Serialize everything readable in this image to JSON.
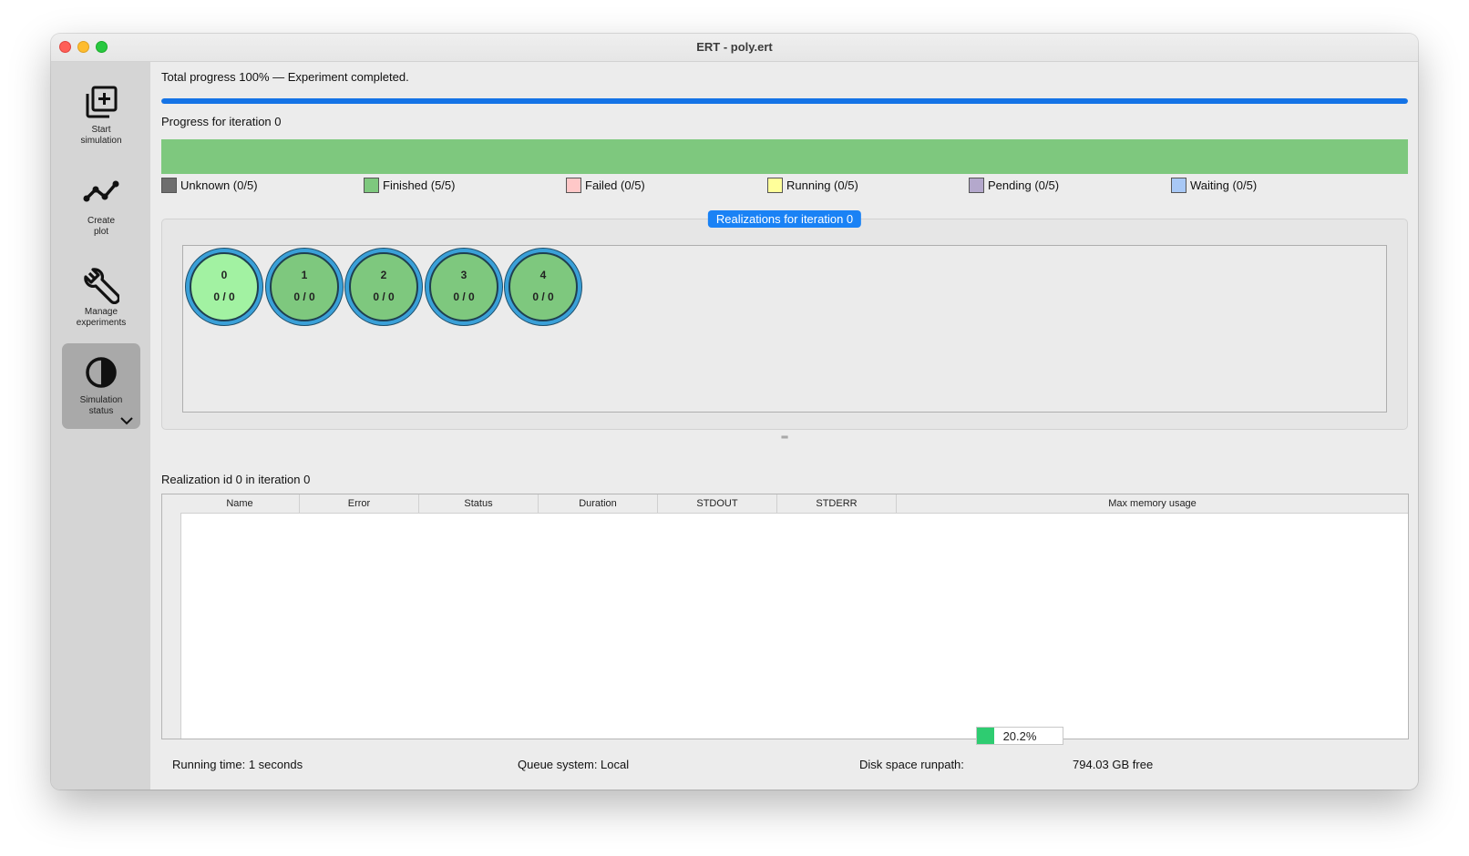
{
  "window": {
    "title": "ERT - poly.ert"
  },
  "sidebar": {
    "items": [
      {
        "label_line1": "Start",
        "label_line2": "simulation",
        "icon": "add-copy-icon"
      },
      {
        "label_line1": "Create",
        "label_line2": "plot",
        "icon": "line-chart-icon"
      },
      {
        "label_line1": "Manage",
        "label_line2": "experiments",
        "icon": "wrench-icon"
      },
      {
        "label_line1": "Simulation",
        "label_line2": "status",
        "icon": "contrast-icon",
        "active": true
      }
    ]
  },
  "progress": {
    "total_text": "Total progress 100% — Experiment completed.",
    "total_fraction": 1.0,
    "iteration_label": "Progress for iteration 0",
    "iteration_fraction": 1.0
  },
  "legend": [
    {
      "label": "Unknown (0/5)",
      "color": "#6e6e6e"
    },
    {
      "label": "Finished (5/5)",
      "color": "#7ec87e"
    },
    {
      "label": "Failed (0/5)",
      "color": "#ffc8c8"
    },
    {
      "label": "Running (0/5)",
      "color": "#ffff9a"
    },
    {
      "label": "Pending (0/5)",
      "color": "#b4a8cc"
    },
    {
      "label": "Waiting (0/5)",
      "color": "#a8c8f5"
    }
  ],
  "realizations": {
    "group_title": "Realizations for iteration 0",
    "items": [
      {
        "id": "0",
        "count": "0 / 0",
        "selected": true
      },
      {
        "id": "1",
        "count": "0 / 0"
      },
      {
        "id": "2",
        "count": "0 / 0"
      },
      {
        "id": "3",
        "count": "0 / 0"
      },
      {
        "id": "4",
        "count": "0 / 0"
      }
    ]
  },
  "details": {
    "title": "Realization id 0 in iteration 0",
    "columns": [
      "Name",
      "Error",
      "Status",
      "Duration",
      "STDOUT",
      "STDERR",
      "Max memory usage"
    ]
  },
  "footer": {
    "running_time": "Running time: 1 seconds",
    "queue_system": "Queue system: Local",
    "disk_label": "Disk space runpath:",
    "disk_percent_text": "20.2%",
    "disk_fraction": 0.202,
    "disk_free": "794.03 GB free"
  },
  "colors": {
    "accent": "#1473e6",
    "finished": "#7ec87e",
    "disk_fill": "#2ecc71"
  }
}
